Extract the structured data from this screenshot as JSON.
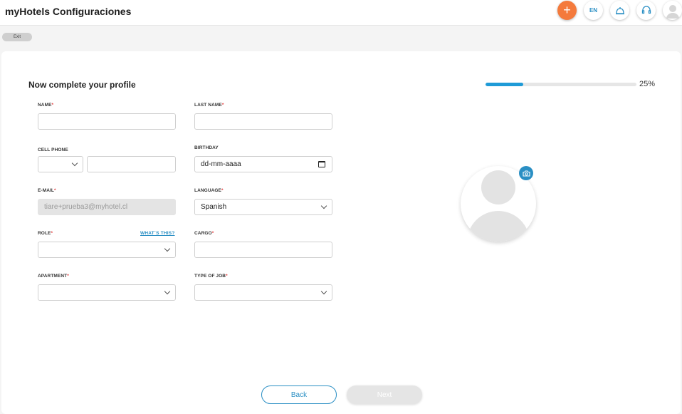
{
  "header": {
    "title": "myHotels Configuraciones",
    "actions": [
      {
        "name": "add",
        "label": "+"
      },
      {
        "name": "language",
        "label": "EN"
      },
      {
        "name": "bell",
        "label": ""
      },
      {
        "name": "support",
        "label": ""
      },
      {
        "name": "user",
        "label": ""
      }
    ]
  },
  "exit_label": "Exit",
  "form": {
    "heading": "Now complete your profile",
    "progress": {
      "percent": 25,
      "label": "25%"
    },
    "name": {
      "label": "NAME",
      "value": ""
    },
    "last_name": {
      "label": "LAST NAME",
      "value": ""
    },
    "cell_phone": {
      "label": "CELL PHONE",
      "code": "",
      "number": ""
    },
    "birthday": {
      "label": "BIRTHDAY",
      "value": "dd-mm-aaaa"
    },
    "email": {
      "label": "E-MAIL",
      "value": "tiare+prueba3@myhotel.cl"
    },
    "language": {
      "label": "LANGUAGE",
      "value": "Spanish"
    },
    "role": {
      "label": "ROLE",
      "value": "",
      "help_link": "WHAT´S THIS?"
    },
    "cargo": {
      "label": "CARGO",
      "value": ""
    },
    "apartment": {
      "label": "APARTMENT",
      "value": ""
    },
    "type_of_job": {
      "label": "TYPE OF JOB",
      "value": ""
    },
    "required_mark": "*"
  },
  "buttons": {
    "back": "Back",
    "next": "Next"
  },
  "colors": {
    "accent": "#2a8fc4",
    "progress": "#1f9bd7",
    "add_button": "#f47a3c",
    "required": "#e03b3b"
  },
  "icons": {
    "camera": "camera-icon",
    "avatar": "user-placeholder-icon"
  }
}
